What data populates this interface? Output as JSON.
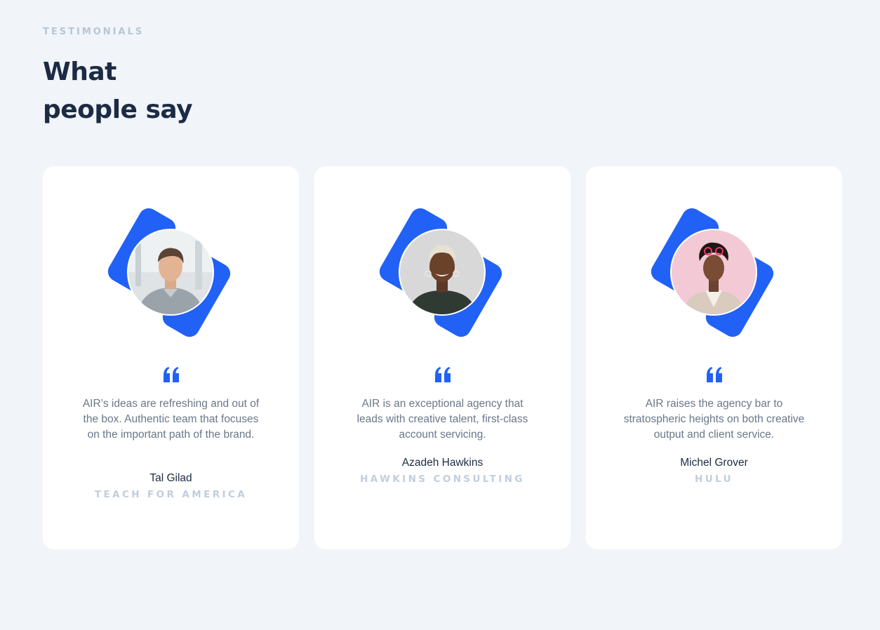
{
  "section": {
    "eyebrow": "TESTIMONIALS",
    "heading_line1": "What",
    "heading_line2": "people say"
  },
  "theme": {
    "accent": "#2161f5",
    "heading_color": "#1c2b45",
    "muted_text": "#6b7787",
    "company_color": "#c1cedc",
    "background": "#f1f4f9"
  },
  "testimonials": [
    {
      "quote": "AIR’s ideas are refreshing and out of the box. Authentic team that focuses on the important path of the brand.",
      "name": "Tal Gilad",
      "company": "TEACH FOR AMERICA",
      "icon": "quote-icon"
    },
    {
      "quote": "AIR is an exceptional agency that leads with creative talent, first-class account servicing.",
      "name": "Azadeh Hawkins",
      "company": "HAWKINS CONSULTING",
      "icon": "quote-icon"
    },
    {
      "quote": "AIR raises the agency bar to stratospheric heights on both creative output and client service.",
      "name": "Michel Grover",
      "company": "HULU",
      "icon": "quote-icon"
    }
  ]
}
